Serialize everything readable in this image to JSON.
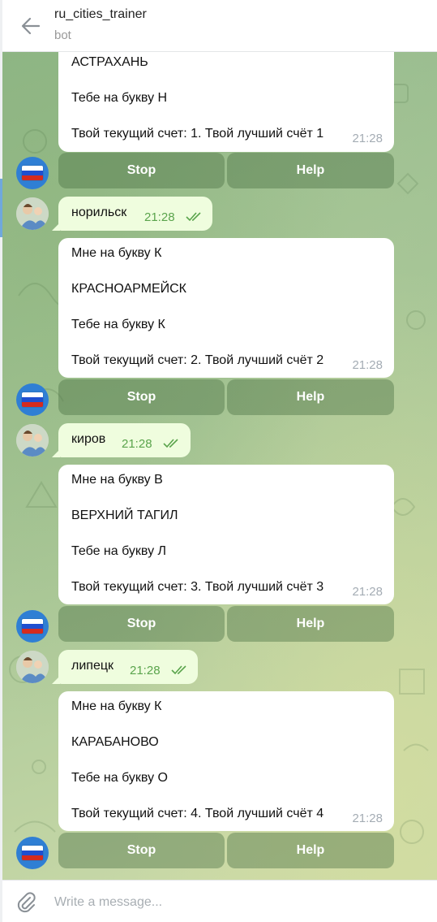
{
  "header": {
    "title": "ru_cities_trainer",
    "subtitle": "bot"
  },
  "messages": [
    {
      "lines": [
        "АСТРАХАНЬ",
        "Тебе на букву Н",
        "Твой текущий счет: 1. Твой лучший счёт 1"
      ],
      "time": "21:28",
      "buttons": [
        "Stop",
        "Help"
      ]
    },
    {
      "user_text": "норильск",
      "user_time": "21:28",
      "lines": [
        "Мне на букву К",
        "КРАСНОАРМЕЙСК",
        "Тебе на букву К",
        "Твой текущий счет: 2. Твой лучший счёт 2"
      ],
      "time": "21:28",
      "buttons": [
        "Stop",
        "Help"
      ]
    },
    {
      "user_text": "киров",
      "user_time": "21:28",
      "lines": [
        "Мне на букву В",
        "ВЕРХНИЙ ТАГИЛ",
        "Тебе на букву Л",
        "Твой текущий счет: 3. Твой лучший счёт 3"
      ],
      "time": "21:28",
      "buttons": [
        "Stop",
        "Help"
      ]
    },
    {
      "user_text": "липецк",
      "user_time": "21:28",
      "lines": [
        "Мне на букву К",
        "КАРАБАНОВО",
        "Тебе на букву О",
        "Твой текущий счет: 4. Твой лучший счёт 4"
      ],
      "time": "21:28",
      "buttons": [
        "Stop",
        "Help"
      ]
    }
  ],
  "composer": {
    "placeholder": "Write a message..."
  },
  "colors": {
    "accent": "#6fa8dc",
    "incoming_bg": "#ffffff",
    "outgoing_bg": "#effdde",
    "read_check": "#5aa44c"
  },
  "icons": {
    "back": "arrow-left-icon",
    "attach": "paperclip-icon",
    "read": "double-check-icon",
    "bot_avatar": "russian-flag-avatar",
    "user_avatar": "user-photo-avatar"
  }
}
